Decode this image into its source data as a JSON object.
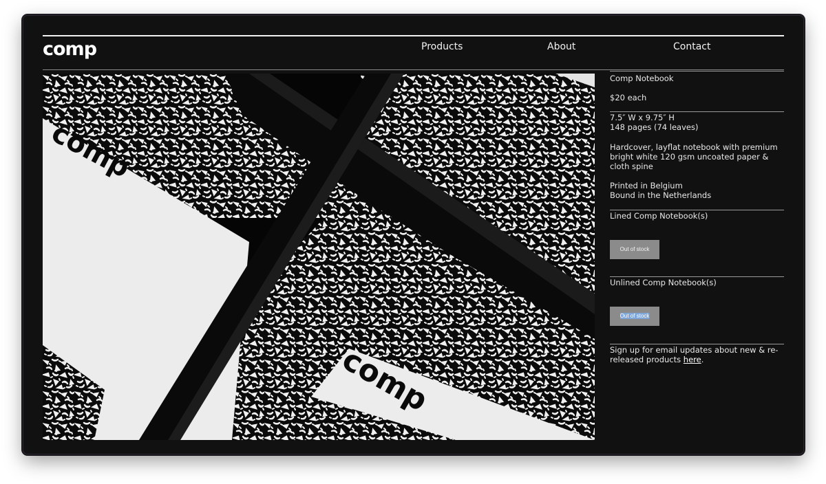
{
  "site": {
    "logo": "comp"
  },
  "nav": {
    "items": [
      {
        "label": "Products"
      },
      {
        "label": "About"
      },
      {
        "label": "Contact"
      }
    ]
  },
  "product": {
    "name": "Comp Notebook",
    "price": "$20 each",
    "dimensions": "7.5″ W x 9.75″ H",
    "pages": "148 pages (74 leaves)",
    "description": "Hardcover, layflat notebook with premium bright white 120 gsm uncoated paper & cloth spine",
    "printed": "Printed in Belgium",
    "bound": "Bound in the Netherlands",
    "variants": [
      {
        "label": "Lined Comp Notebook(s)",
        "button": "Out of stock"
      },
      {
        "label": "Unlined Comp Notebook(s)",
        "button": "Out of stock"
      }
    ],
    "signup_text": "Sign up for email updates about new & re-released products ",
    "signup_link": "here",
    "signup_end": "."
  },
  "photo": {
    "cover_text_1": "comp",
    "cover_text_2": "comp"
  },
  "colors": {
    "background": "#111112",
    "button": "#8b8b8b",
    "selection": "#7fa6d8"
  }
}
